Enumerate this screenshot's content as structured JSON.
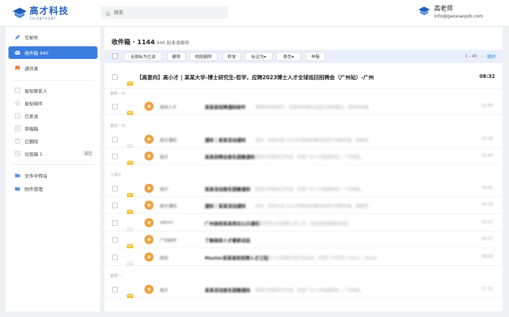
{
  "brand": {
    "cn": "高才科技",
    "en": "TALENTHUNT",
    "color": "#1f5fb8"
  },
  "search": {
    "placeholder": "搜索"
  },
  "user": {
    "name": "高老师",
    "email": "info@gaoxiaojob.com"
  },
  "sidebar": {
    "compose": "写邮件",
    "inbox": "收件箱 940",
    "drafts": "通讯录",
    "items": [
      {
        "label": "星标联系人",
        "icon": "star-contact-icon"
      },
      {
        "label": "星标邮件",
        "icon": "star-icon"
      },
      {
        "label": "已发送",
        "icon": "sent-icon"
      },
      {
        "label": "草稿箱",
        "icon": "draft-icon"
      },
      {
        "label": "已删除",
        "icon": "trash-icon"
      },
      {
        "label": "垃圾箱 1",
        "icon": "spam-icon",
        "count": "清空"
      }
    ],
    "folders": [
      {
        "label": "文件中转站",
        "icon": "folder-icon"
      },
      {
        "label": "附件管理",
        "icon": "attachment-icon"
      }
    ]
  },
  "main": {
    "title": "收件箱 · 1144",
    "subtitle": "/   940 封未读邮件"
  },
  "toolbar": {
    "mark_all_read": "全部标为已读",
    "delete": "删除",
    "delete_perm": "彻底删除",
    "forward": "转发",
    "mark_as": "标记为▾",
    "move_to": "移至▾",
    "report": "举报",
    "page_prev": "‹",
    "page_range": "1 - 45",
    "page_next": "›",
    "jump": "跳转"
  },
  "pinned": {
    "text": "【高意向】高小才 | 某某大学-博士研究生-哲学，应聘2023博士人才全球巡回招聘会（广州站）-广州",
    "time": "08:32"
  },
  "groups": [
    {
      "label": "最新一天",
      "rows": [
        {
          "sender": "高校人才",
          "subject": "某某某招聘通知邮件",
          "preview": "尊敬的老师您好，您发布的职位信息已审核通过，请及时查看",
          "time": "15:06",
          "env": "#f2c230"
        }
      ]
    },
    {
      "label": "最近一天",
      "rows": [
        {
          "sender": "高才通知",
          "subject": "通知｜某某活动通知",
          "preview": "您好，您参与的 2023年某某招聘活动将于近期开展，请留意",
          "time": "13:18",
          "env": "#e8e8e8"
        },
        {
          "sender": "高才",
          "subject": "某某招聘会报名提醒通知",
          "preview": "某某大学报名已开启，欢迎广大人才投递简历，广州地区。",
          "time": "11:20",
          "env": "#f2c230"
        }
      ]
    },
    {
      "label": "上周五",
      "rows": [
        {
          "sender": "高才",
          "subject": "某某活动报名提醒通知",
          "preview": "某某大学报名已开启，欢迎广大人才投递简历，广州地区。",
          "time": "18:42",
          "env": "#f2c230"
        },
        {
          "sender": "高才通知",
          "subject": "通知｜某某活动通知",
          "preview": "您好，您参与的 2023年某某招聘活动将于近期开展，请留意",
          "time": "16:23",
          "env": "#f2c230"
        },
        {
          "sender": "admin",
          "subject": "广州高校某某岗位公示通知",
          "preview": "某某学院公开招聘工作人员，欢迎有意者报名参加。",
          "time": "10:11",
          "env": "#e8e8e8"
        },
        {
          "sender": "广告邮件",
          "subject": "了解高校人才最新动态",
          "preview": "",
          "time": "09:07",
          "env": "#f2c230"
        },
        {
          "sender": "高校",
          "subject": "Master某某高校招聘人才工程",
          "preview": "某某高校人才发展计划正式启动，欢迎广大优秀人才加入。Maste",
          "time": "08:40",
          "env": "#e8e8e8"
        }
      ]
    },
    {
      "label": "星期一",
      "rows": [
        {
          "sender": "高才",
          "subject": "某某活动报名提醒通知",
          "preview": "某某大学报名已开启，欢迎广大人才投递简历，广州地区。",
          "time": "17:12",
          "env": "#f2c230"
        }
      ]
    }
  ],
  "colors": {
    "accent": "#3b7ddd",
    "avatar": "#f0a040",
    "toolbar_bg": "#e9f0fb"
  }
}
